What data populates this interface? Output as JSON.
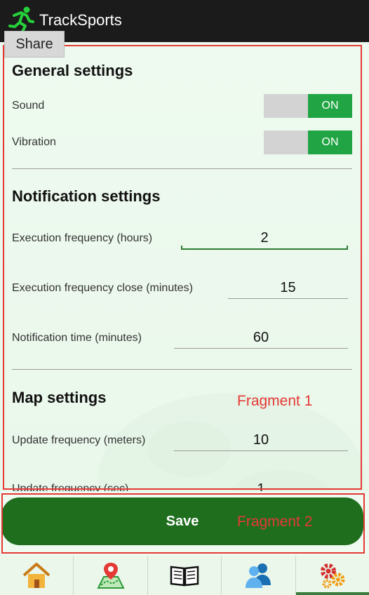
{
  "app": {
    "title": "TrackSports",
    "share_label": "Share"
  },
  "general": {
    "title": "General settings",
    "sound_label": "Sound",
    "sound_state": "ON",
    "vibration_label": "Vibration",
    "vibration_state": "ON"
  },
  "notification": {
    "title": "Notification settings",
    "exec_freq_label": "Execution frequency (hours)",
    "exec_freq_value": "2",
    "exec_close_label": "Execution frequency close (minutes)",
    "exec_close_value": "15",
    "notif_time_label": "Notification time (minutes)",
    "notif_time_value": "60"
  },
  "map": {
    "title": "Map settings",
    "update_meters_label": "Update frequency (meters)",
    "update_meters_value": "10",
    "update_sec_label": "Update frequency (sec)",
    "update_sec_value": "1"
  },
  "annotations": {
    "fragment1": "Fragment 1",
    "fragment2": "Fragment 2"
  },
  "save": {
    "label": "Save"
  },
  "nav": {
    "items": [
      "home-icon",
      "map-pin-icon",
      "book-icon",
      "users-icon",
      "settings-gears-icon"
    ],
    "active": "settings-gears-icon"
  },
  "colors": {
    "toggle_on": "#21a544",
    "save_button": "#1e6e1e",
    "annotation": "#e53935"
  }
}
